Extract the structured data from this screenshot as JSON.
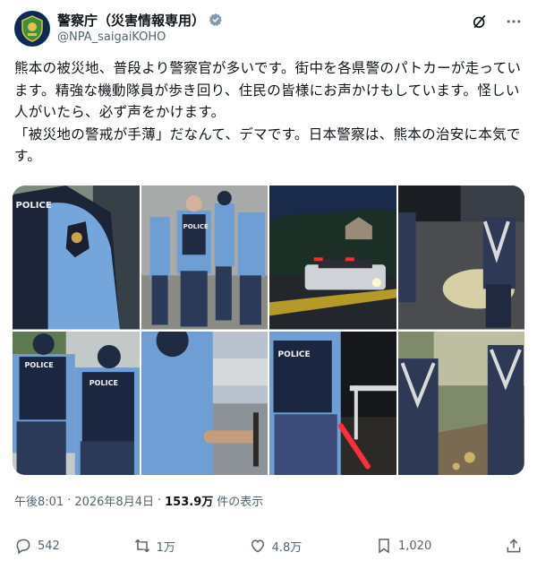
{
  "account": {
    "display_name": "警察庁（災害情報専用）",
    "handle": "@NPA_saigaiKOHO",
    "verified_icon": "verified-badge-icon"
  },
  "header_icons": [
    "grok-icon",
    "more-icon"
  ],
  "tweet": {
    "text": "熊本の被災地、普段より警察官が多いです。街中を各県警のパトカーが走っています。精強な機動隊員が歩き回り、住民の皆様にお声かけもしています。怪しい人がいたら、必ず声をかけます。\n「被災地の警戒が手薄」だなんて、デマです。日本警察は、熊本の治安に本気です。"
  },
  "media": {
    "photos": [
      {
        "id": "photo-1",
        "vest_text": "POLICE"
      },
      {
        "id": "photo-2",
        "vest_text": "POLICE"
      },
      {
        "id": "photo-3"
      },
      {
        "id": "photo-4"
      },
      {
        "id": "photo-5",
        "vest_text": "POLICE"
      },
      {
        "id": "photo-6"
      },
      {
        "id": "photo-7",
        "vest_text": "POLICE"
      },
      {
        "id": "photo-8"
      }
    ]
  },
  "meta": {
    "time": "午後8:01",
    "separator": "·",
    "date": "2026年8月4日",
    "separator2": "·",
    "views": "153.9万",
    "views_suffix": "件の表示"
  },
  "actions": {
    "replies": "542",
    "reposts": "1万",
    "likes": "4.8万",
    "bookmarks": "1,020"
  },
  "colors": {
    "text": "#0f1419",
    "muted": "#536471",
    "verified": "#829aab",
    "police_blue": "#6fa0d6",
    "vest_navy": "#1c2a44"
  }
}
